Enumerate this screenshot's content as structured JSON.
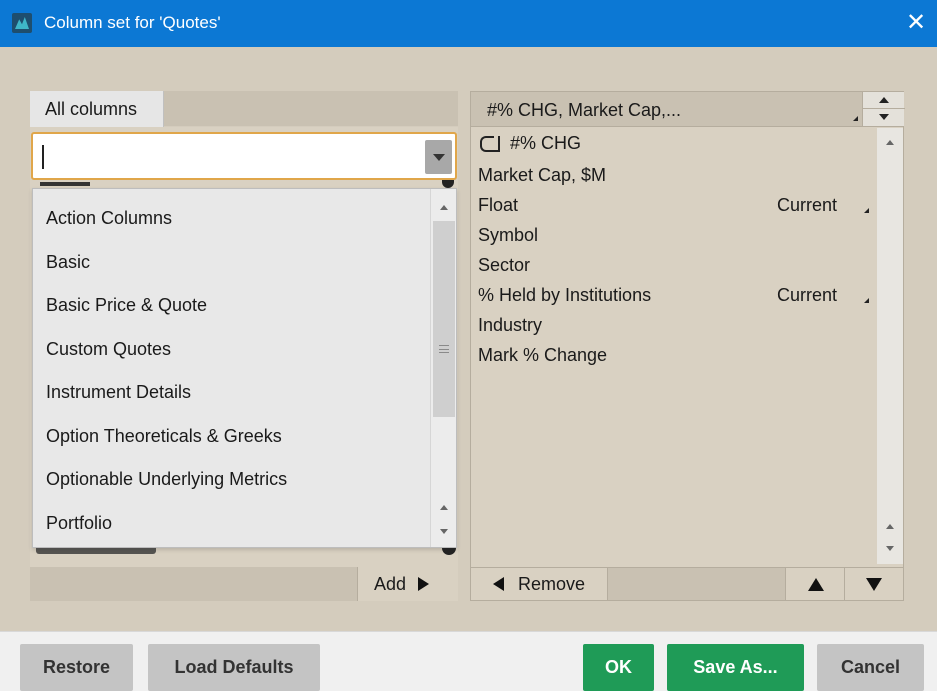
{
  "window": {
    "title": "Column set for 'Quotes'",
    "close_glyph": "✕"
  },
  "left_panel": {
    "tab_label": "All columns",
    "search": {
      "value": "",
      "placeholder": ""
    },
    "dropdown_items": [
      "Action Columns",
      "Basic",
      "Basic Price & Quote",
      "Custom Quotes",
      "Instrument Details",
      "Option Theoreticals & Greeks",
      "Optionable Underlying Metrics",
      "Portfolio"
    ],
    "add_label": "Add"
  },
  "right_panel": {
    "header_label": "#% CHG, Market Cap,...",
    "rows": [
      {
        "label": "#% CHG",
        "value": "",
        "icon": "scroll-icon"
      },
      {
        "label": "Market Cap, $M",
        "value": ""
      },
      {
        "label": "Float",
        "value": "Current"
      },
      {
        "label": "Symbol",
        "value": ""
      },
      {
        "label": "Sector",
        "value": ""
      },
      {
        "label": "% Held by Institutions",
        "value": "Current"
      },
      {
        "label": "Industry",
        "value": ""
      },
      {
        "label": "Mark % Change",
        "value": ""
      }
    ],
    "remove_label": "Remove"
  },
  "buttons": {
    "restore": "Restore",
    "load_defaults": "Load Defaults",
    "ok": "OK",
    "save_as": "Save As...",
    "cancel": "Cancel"
  },
  "colors": {
    "titlebar": "#0c78d4",
    "panel_bg": "#d4ccbd",
    "accent_green": "#1f9b57",
    "focus_border": "#e0a64a"
  }
}
